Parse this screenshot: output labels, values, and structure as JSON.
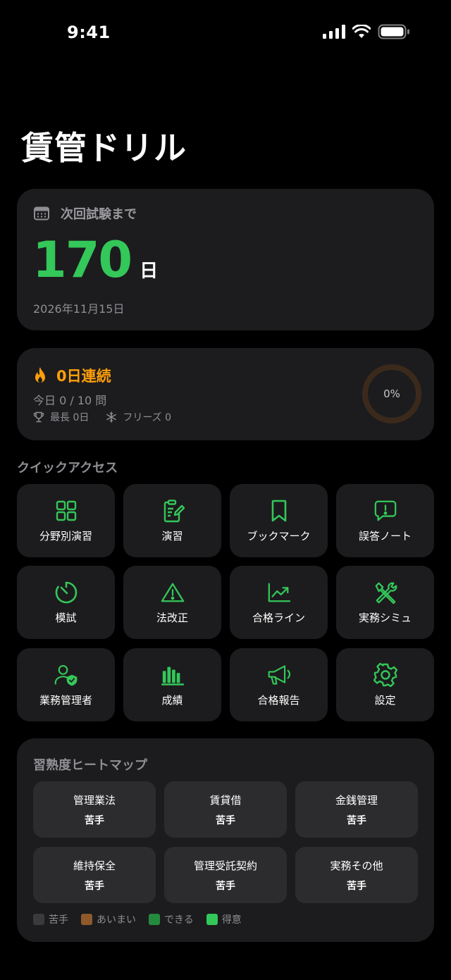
{
  "status_bar": {
    "time": "9:41"
  },
  "app": {
    "title": "賃管ドリル"
  },
  "exam": {
    "label": "次回試験まで",
    "days": "170",
    "days_unit": "日",
    "date": "2026年11月15日"
  },
  "streak": {
    "title": "0日連続",
    "today": "今日 0 / 10 問",
    "best": "最長 0日",
    "freeze": "フリーズ 0",
    "progress_text": "0%",
    "progress_fraction": 0
  },
  "quick_access": {
    "title": "クイックアクセス",
    "items": [
      {
        "label": "分野別演習",
        "icon": "grid-icon"
      },
      {
        "label": "演習",
        "icon": "clipboard-edit-icon"
      },
      {
        "label": "ブックマーク",
        "icon": "bookmark-icon"
      },
      {
        "label": "誤答ノート",
        "icon": "message-alert-icon"
      },
      {
        "label": "模試",
        "icon": "timer-icon"
      },
      {
        "label": "法改正",
        "icon": "warning-icon"
      },
      {
        "label": "合格ライン",
        "icon": "chart-trend-icon"
      },
      {
        "label": "実務シミュ",
        "icon": "tools-icon"
      },
      {
        "label": "業務管理者",
        "icon": "user-shield-icon"
      },
      {
        "label": "成績",
        "icon": "bar-chart-icon"
      },
      {
        "label": "合格報告",
        "icon": "megaphone-icon"
      },
      {
        "label": "設定",
        "icon": "gear-icon"
      }
    ]
  },
  "heatmap": {
    "title": "習熟度ヒートマップ",
    "cells": [
      {
        "name": "管理業法",
        "level": "苦手"
      },
      {
        "name": "賃貸借",
        "level": "苦手"
      },
      {
        "name": "金銭管理",
        "level": "苦手"
      },
      {
        "name": "維持保全",
        "level": "苦手"
      },
      {
        "name": "管理受託契約",
        "level": "苦手"
      },
      {
        "name": "実務その他",
        "level": "苦手"
      }
    ],
    "legend": [
      {
        "label": "苦手",
        "color": "#3a3a3c"
      },
      {
        "label": "あいまい",
        "color": "#8e5a2b"
      },
      {
        "label": "できる",
        "color": "#248a3d"
      },
      {
        "label": "得意",
        "color": "#34c759"
      }
    ]
  },
  "colors": {
    "accent": "#34c759",
    "streak": "#ff9f0a",
    "card": "#1c1c1e",
    "cell": "#2c2c2e"
  }
}
